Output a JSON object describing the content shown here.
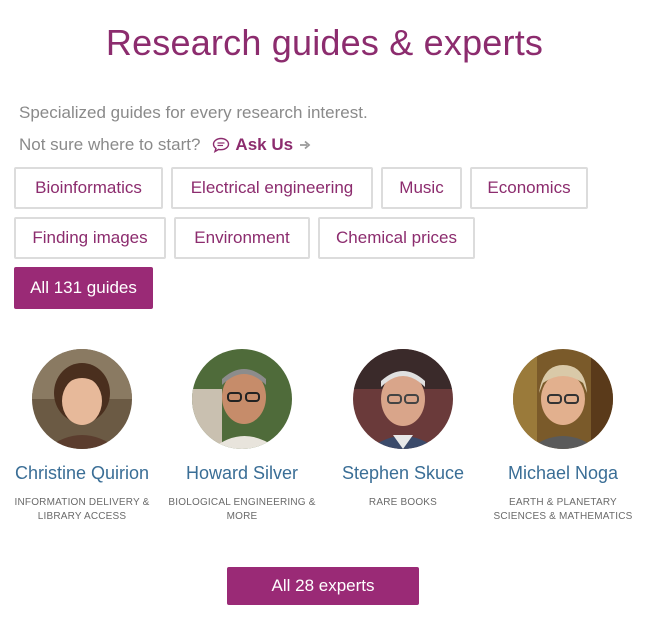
{
  "header": {
    "title": "Research guides & experts"
  },
  "intro": {
    "tagline": "Specialized guides for every research interest.",
    "ask_prompt": "Not sure where to start?",
    "ask_link": "Ask Us"
  },
  "guides": [
    {
      "label": "Bioinformatics"
    },
    {
      "label": "Electrical engineering"
    },
    {
      "label": "Music"
    },
    {
      "label": "Economics"
    },
    {
      "label": "Finding images"
    },
    {
      "label": "Environment"
    },
    {
      "label": "Chemical prices"
    }
  ],
  "all_guides_label": "All 131 guides",
  "experts": [
    {
      "name": "Christine Quirion",
      "dept_line1": "Information Delivery &",
      "dept_line2": "Library Access"
    },
    {
      "name": "Howard Silver",
      "dept_line1": "Biological Engineering &",
      "dept_line2": "More"
    },
    {
      "name": "Stephen Skuce",
      "dept_line1": "Rare Books",
      "dept_line2": ""
    },
    {
      "name": "Michael Noga",
      "dept_line1": "Earth & Planetary",
      "dept_line2": "Sciences & Mathematics"
    }
  ],
  "all_experts_label": "All 28 experts",
  "colors": {
    "accent": "#9a2a76",
    "title": "#8c2c6e",
    "link": "#3a6e96"
  }
}
